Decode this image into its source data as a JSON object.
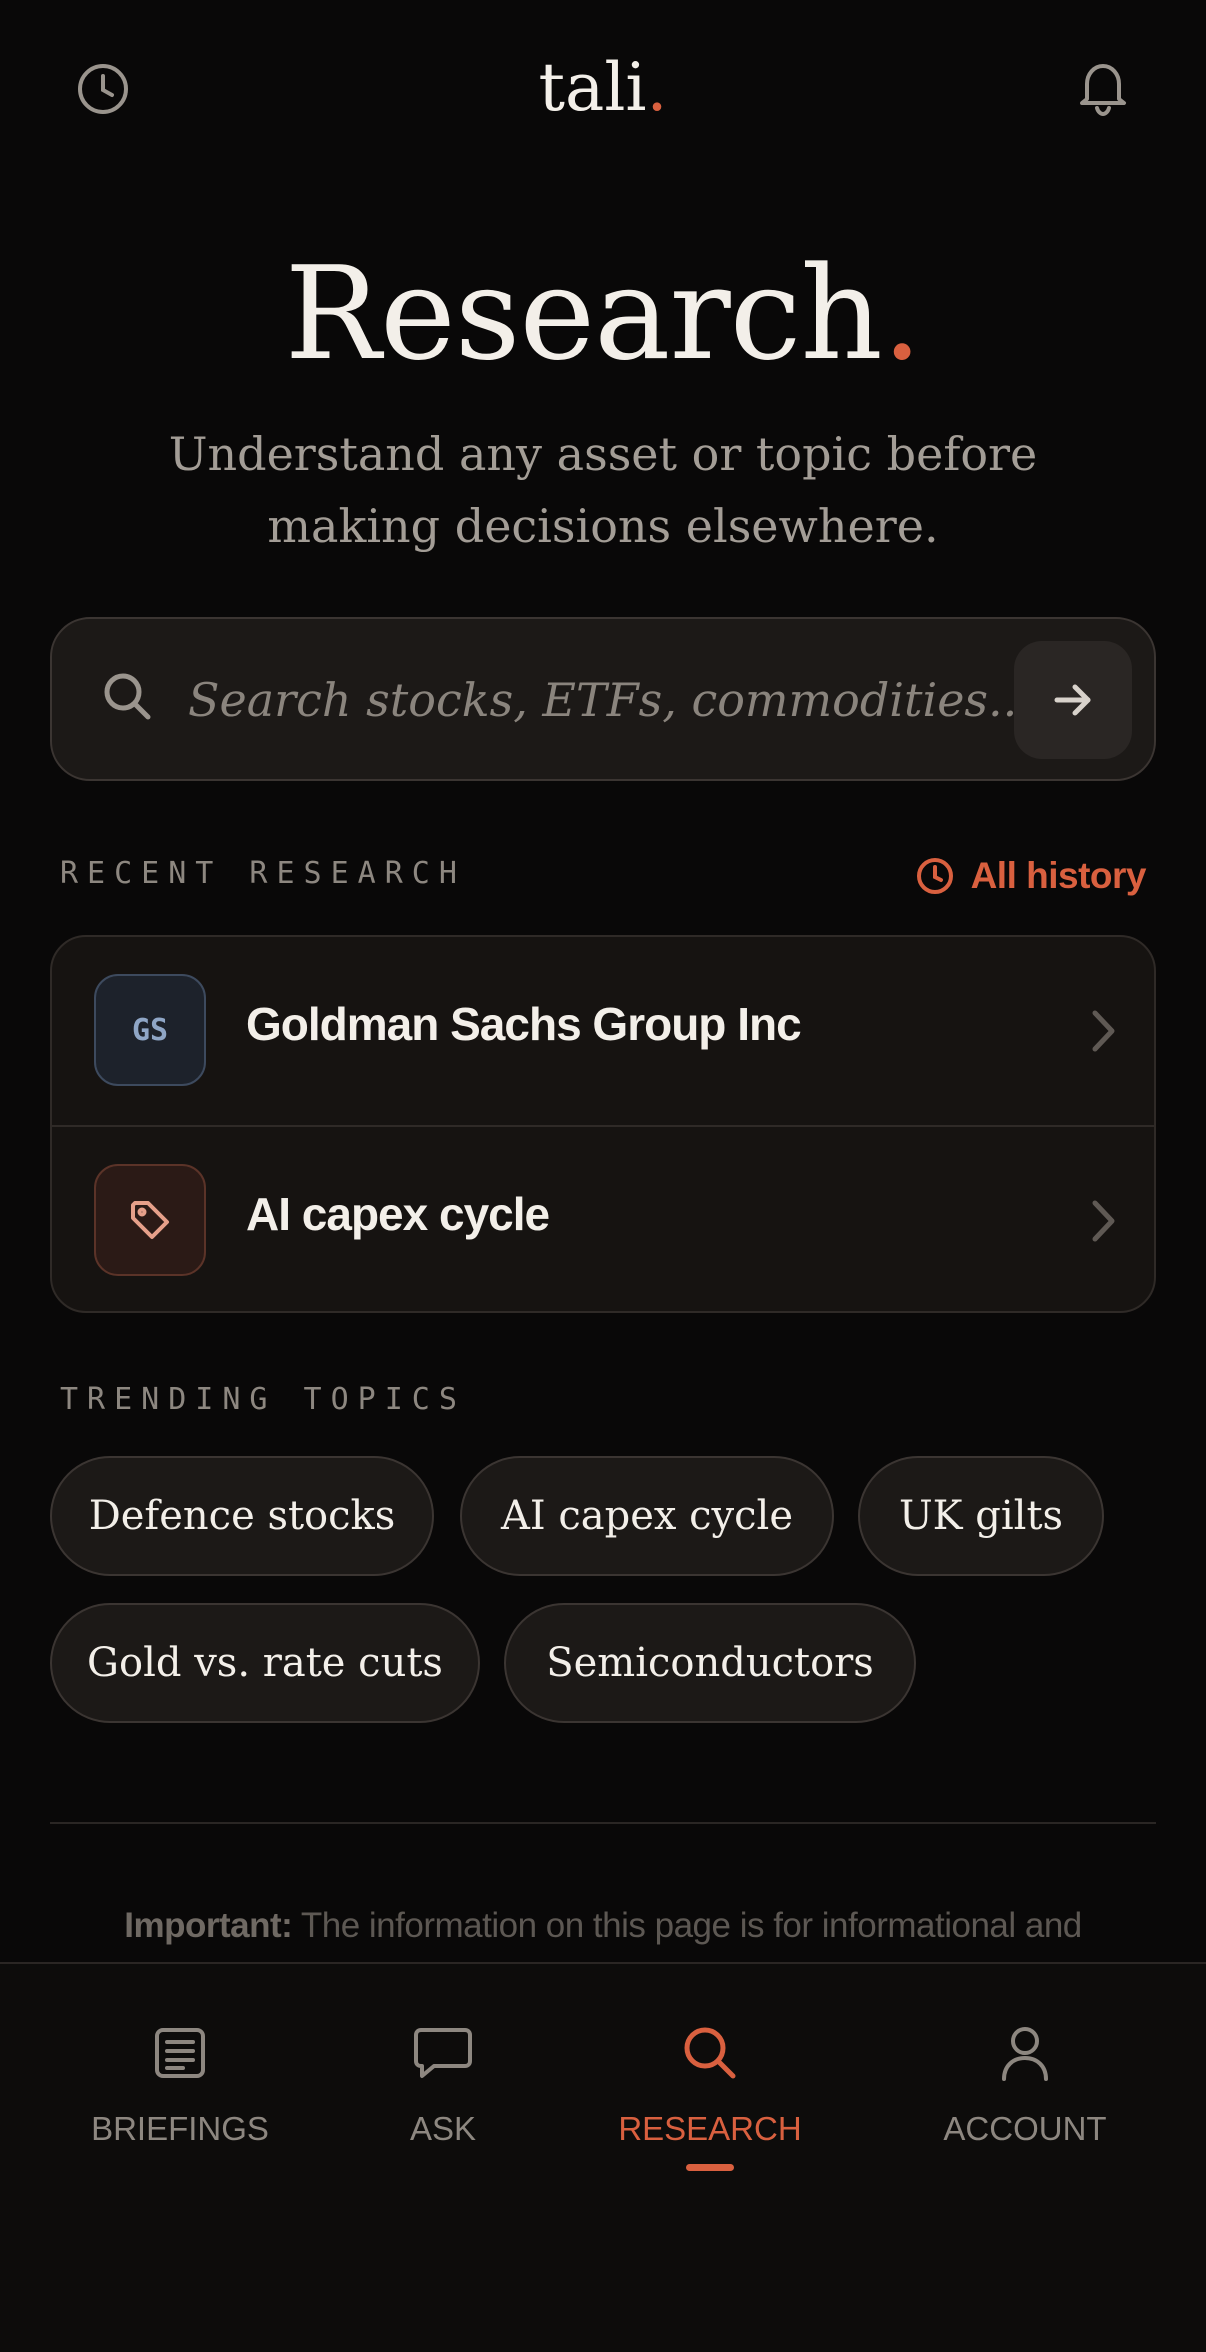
{
  "header": {
    "brand": "tali",
    "brand_dot": ".",
    "left_icon": "history-clock-icon",
    "right_icon": "bell-icon"
  },
  "hero": {
    "title": "Research",
    "title_dot": ".",
    "subtitle_line1": "Understand any asset or topic before",
    "subtitle_line2": "making decisions elsewhere."
  },
  "search": {
    "placeholder": "Search stocks, ETFs, commodities...",
    "value": "",
    "icon": "search-icon",
    "submit_icon": "arrow-right-icon"
  },
  "recent": {
    "label": "RECENT RESEARCH",
    "all_history_label": "All history",
    "items": [
      {
        "badge": "GS",
        "title": "Goldman Sachs Group Inc"
      },
      {
        "badge_icon": "tag-icon",
        "title": "AI capex cycle"
      }
    ]
  },
  "trending": {
    "label": "TRENDING TOPICS",
    "chips": [
      "Defence stocks",
      "AI capex cycle",
      "UK gilts",
      "Gold vs. rate cuts",
      "Semiconductors"
    ]
  },
  "disclaimer": {
    "bold": "Important:",
    "text": " The information on this page is for informational and"
  },
  "nav": {
    "items": [
      {
        "label": "BRIEFINGS",
        "icon": "briefings-icon"
      },
      {
        "label": "ASK",
        "icon": "chat-icon"
      },
      {
        "label": "RESEARCH",
        "icon": "search-icon",
        "active": true
      },
      {
        "label": "ACCOUNT",
        "icon": "user-icon"
      }
    ]
  },
  "colors": {
    "background": "#090808",
    "accent": "#d9603f",
    "text": "#f3efe9",
    "muted": "#8d8780"
  }
}
